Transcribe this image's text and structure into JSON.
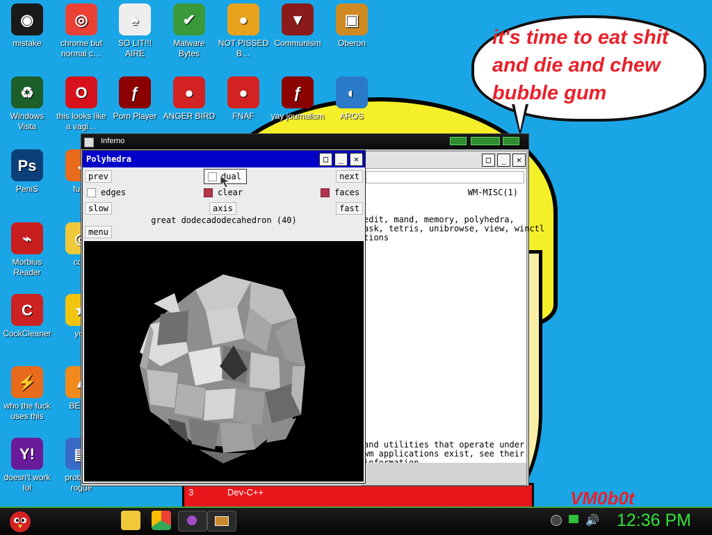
{
  "desktop": {
    "icons": [
      {
        "label": "mistake",
        "icon": "razer-icon",
        "color": "#1a1a1a"
      },
      {
        "label": "chrome but normal c…",
        "icon": "chrome-icon",
        "color": "#e94235"
      },
      {
        "label": "SO LIT!!! AIRE",
        "icon": "solitaire-icon",
        "color": "#eeeeee"
      },
      {
        "label": "Malware Bytes",
        "icon": "shield-check-icon",
        "color": "#3a9a3a"
      },
      {
        "label": "NOT PISSED B…",
        "icon": "green-pig-icon",
        "color": "#e8a21c"
      },
      {
        "label": "Communism",
        "icon": "winged-emblem-icon",
        "color": "#8b1a1a"
      },
      {
        "label": "Oberon",
        "icon": "oberon-icon",
        "color": "#d08a24"
      },
      {
        "label": "Windows Vista",
        "icon": "recycle-icon",
        "color": "#1d5e2a"
      },
      {
        "label": "this looks like a vagi…",
        "icon": "opera-icon",
        "color": "#d8121c"
      },
      {
        "label": "Porn Player",
        "icon": "flash-icon",
        "color": "#8b0000"
      },
      {
        "label": "ANGER BIRD",
        "icon": "angry-bird-icon",
        "color": "#d32222"
      },
      {
        "label": "FNAF",
        "icon": "angry-bird-icon",
        "color": "#d32222"
      },
      {
        "label": "yay journalism",
        "icon": "flash-icon",
        "color": "#8b0000"
      },
      {
        "label": "AROS",
        "icon": "cat-eye-icon",
        "color": "#2a7ac8"
      },
      {
        "label": "PeniS",
        "icon": "photoshop-icon",
        "color": "#0b3f78"
      },
      {
        "label": "furry",
        "icon": "firefox-icon",
        "color": "#e86b1c"
      },
      {
        "label": "Morbius Reader",
        "icon": "pdf-icon",
        "color": "#c81e1e"
      },
      {
        "label": "cd d",
        "icon": "disc-icon",
        "color": "#f0c93b"
      },
      {
        "label": "CockCleaner",
        "icon": "ccleaner-icon",
        "color": "#cc2222"
      },
      {
        "label": "you",
        "icon": "star-icon",
        "color": "#f1c40f"
      },
      {
        "label": "who the fuck uses this",
        "icon": "lightning-icon",
        "color": "#e86b1c"
      },
      {
        "label": "BE BE",
        "icon": "vlc-cone-icon",
        "color": "#f08a1c"
      },
      {
        "label": "doesn't work lol",
        "icon": "yahoo-icon",
        "color": "#6a1b9a"
      },
      {
        "label": "probab a rogue",
        "icon": "installer-icon",
        "color": "#3a6ac8"
      }
    ]
  },
  "bubble": {
    "text": "it's time to eat shit and die and chew bubble gum"
  },
  "signature": "VM0b0t",
  "wallpaper": {
    "item_number": "3",
    "item_label": "Dev-C++"
  },
  "inferno": {
    "title": "Inferno"
  },
  "manwin": {
    "header": "WM-MISC(1)",
    "lines": [
      "edit, mand, memory, polyhedra,",
      "ask, tetris, unibrowse, view, winctl",
      "tions"
    ],
    "footer_lines": [
      " and utilities that operate under",
      "wm applications exist, see their",
      " information"
    ]
  },
  "polyhedra": {
    "title": "Polyhedra",
    "buttons": {
      "prev": "prev",
      "next": "next",
      "slow": "slow",
      "axis": "axis",
      "fast": "fast",
      "menu": "menu"
    },
    "checks": {
      "dual": "dual",
      "edges": "edges",
      "clear": "clear",
      "faces": "faces"
    },
    "checked": {
      "dual": false,
      "edges": false,
      "clear": true,
      "faces": true
    },
    "shape_name": "great dodecadodecahedron (40)"
  },
  "taskbar": {
    "clock": "12:36 PM",
    "items": [
      "angry-bird-start-icon",
      "folder-icon",
      "chrome-icon",
      "inferno-icon",
      "terminal-icon"
    ],
    "tray": [
      "chevron-icon",
      "network-icon",
      "volume-icon"
    ]
  }
}
